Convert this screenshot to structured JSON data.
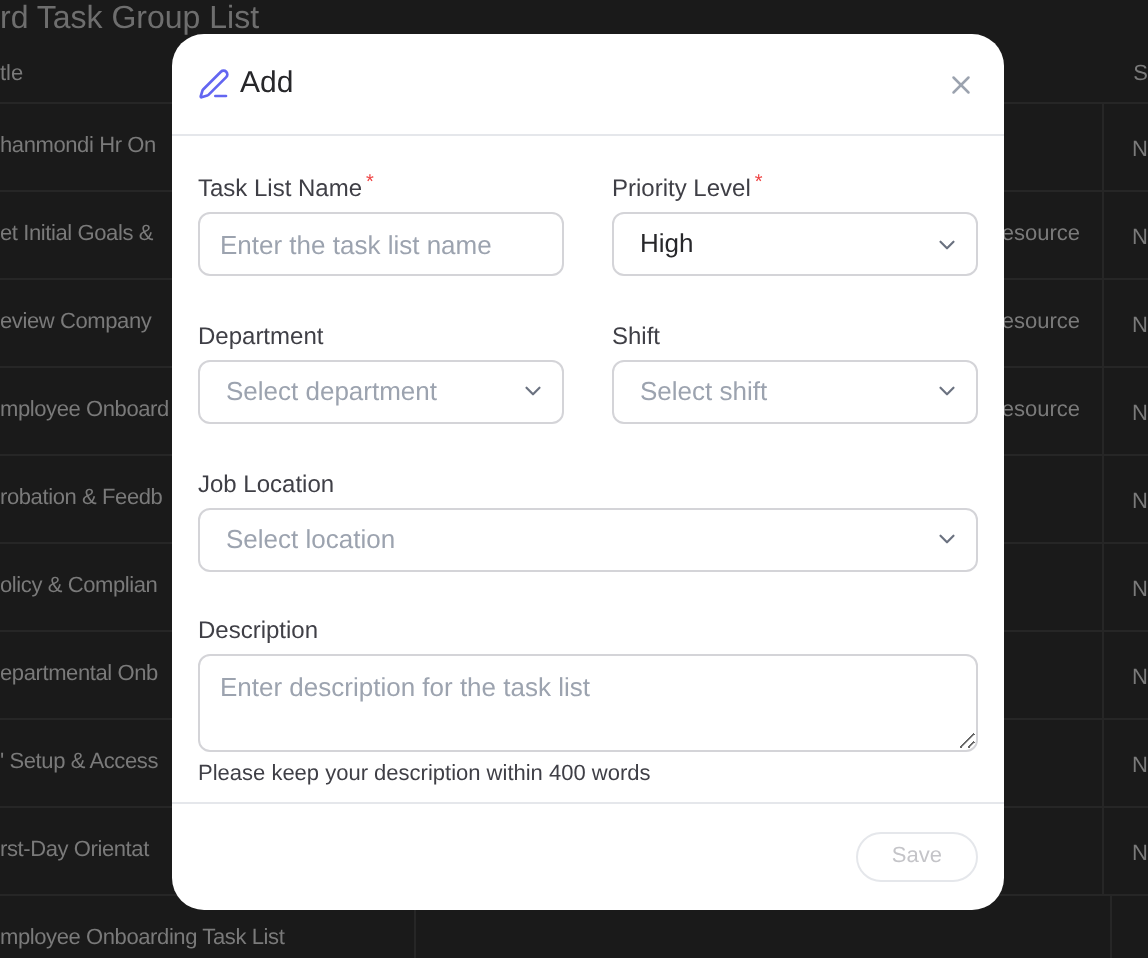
{
  "page": {
    "title": "rd Task Group List",
    "table": {
      "columns": [
        {
          "label": "tle"
        },
        {
          "label": "S"
        }
      ],
      "rows": [
        {
          "column_1": "hanmondi Hr On",
          "column_3": "N"
        },
        {
          "column_1": "et Initial Goals &",
          "column_2": "esource",
          "column_3": "N"
        },
        {
          "column_1": "eview Company",
          "column_2": "esource",
          "column_3": "N"
        },
        {
          "column_1": "mployee Onboard",
          "column_2": "esource",
          "column_3": "N"
        },
        {
          "column_1": "robation & Feedb",
          "column_3": "N"
        },
        {
          "column_1": "olicy & Complian",
          "column_3": "N"
        },
        {
          "column_1": "epartmental Onb",
          "column_3": "N"
        },
        {
          "column_1": "' Setup & Access",
          "column_3": "N"
        },
        {
          "column_1": "rst-Day Orientat",
          "column_3": "N"
        },
        {
          "column_1": "mployee Onboarding Task List"
        }
      ]
    }
  },
  "dialog": {
    "title": "Add",
    "fields": [
      {
        "kind": "text",
        "label": "Task List Name",
        "required_mark": "*",
        "placeholder": "Enter the task list name"
      },
      {
        "kind": "select",
        "label": "Priority Level",
        "required_mark": "*",
        "value": "High"
      },
      {
        "kind": "select",
        "label": "Department",
        "placeholder": "Select department"
      },
      {
        "kind": "select",
        "label": "Shift",
        "placeholder": "Select shift"
      },
      {
        "kind": "select",
        "label": "Job Location",
        "placeholder": "Select location",
        "wide": true
      },
      {
        "kind": "textarea",
        "label": "Description",
        "placeholder": "Enter description for the task list",
        "hint": "Please keep your description within 400 words",
        "wide": true
      }
    ],
    "save": {
      "label": "Save",
      "disabled": true
    }
  }
}
